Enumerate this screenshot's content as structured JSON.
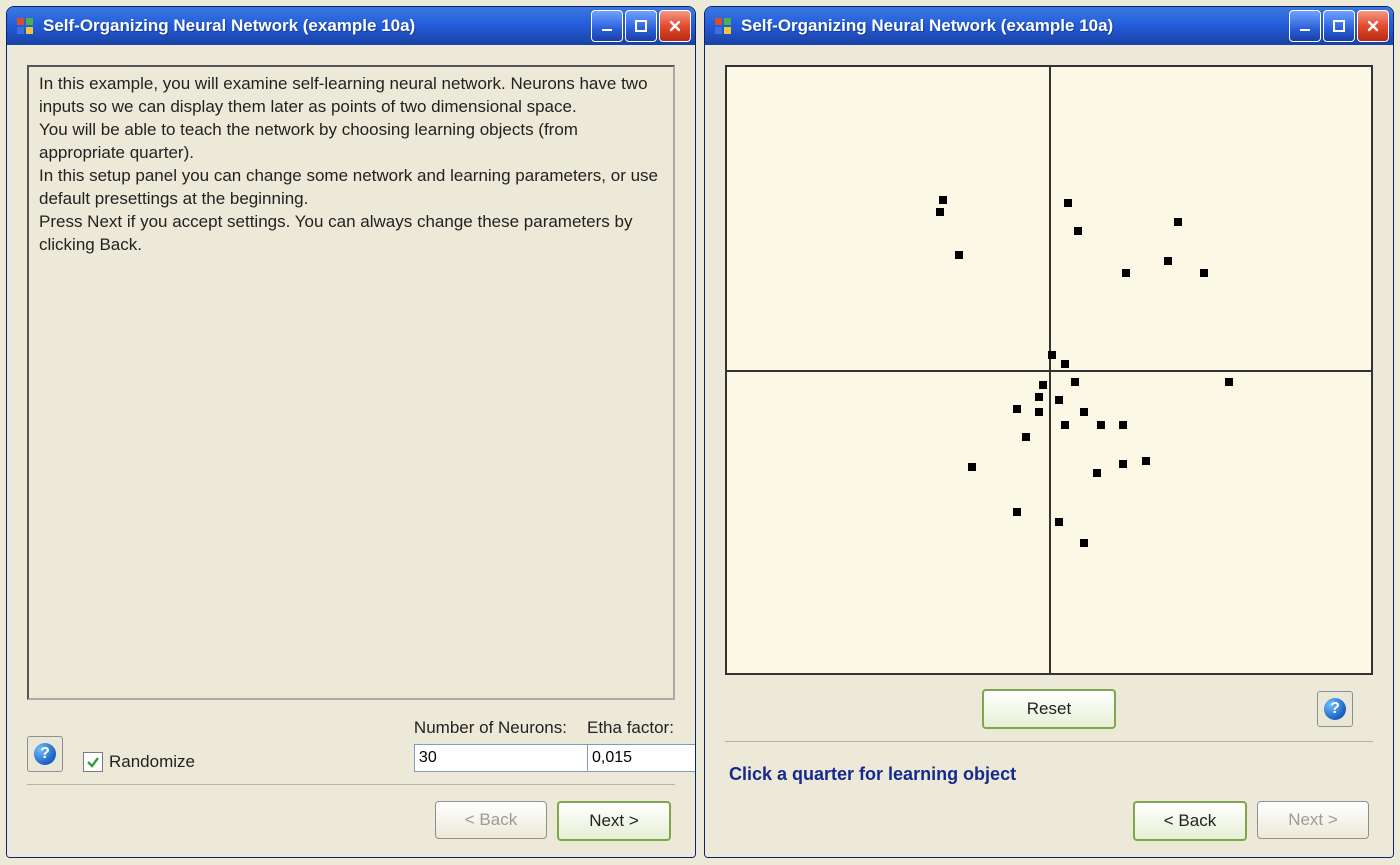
{
  "windows": {
    "left": {
      "title": "Self-Organizing Neural Network (example 10a)",
      "description": "In this example, you will examine self-learning neural network. Neurons have two inputs so we can display them later as points of two dimensional space.\nYou will be able to teach the network by choosing learning objects (from appropriate quarter).\nIn this setup panel you can change some network and learning parameters, or use default presettings at the beginning.\nPress Next if you accept settings. You can always change these parameters by clicking Back.",
      "randomize_label": "Randomize",
      "randomize_checked": true,
      "neurons_label": "Number of Neurons:",
      "neurons_value": "30",
      "etha_label": "Etha factor:",
      "etha_value": "0,015",
      "back_label": "< Back",
      "next_label": "Next >",
      "back_enabled": false,
      "next_enabled": true
    },
    "right": {
      "title": "Self-Organizing Neural Network (example 10a)",
      "reset_label": "Reset",
      "hint": "Click a quarter for learning object",
      "back_label": "< Back",
      "next_label": "Next >",
      "back_enabled": true,
      "next_enabled": false
    }
  },
  "chart_data": {
    "type": "scatter",
    "title": "",
    "xlabel": "",
    "ylabel": "",
    "xlim": [
      -1,
      1
    ],
    "ylim": [
      -1,
      1
    ],
    "series": [
      {
        "name": "neurons",
        "points": [
          {
            "x": -0.34,
            "y": 0.52
          },
          {
            "x": -0.33,
            "y": 0.56
          },
          {
            "x": 0.06,
            "y": 0.55
          },
          {
            "x": -0.28,
            "y": 0.38
          },
          {
            "x": 0.09,
            "y": 0.46
          },
          {
            "x": 0.4,
            "y": 0.49
          },
          {
            "x": 0.37,
            "y": 0.36
          },
          {
            "x": 0.24,
            "y": 0.32
          },
          {
            "x": 0.48,
            "y": 0.32
          },
          {
            "x": 0.56,
            "y": -0.04
          },
          {
            "x": 0.01,
            "y": 0.05
          },
          {
            "x": 0.05,
            "y": 0.02
          },
          {
            "x": -0.02,
            "y": -0.05
          },
          {
            "x": -0.03,
            "y": -0.09
          },
          {
            "x": -0.1,
            "y": -0.13
          },
          {
            "x": -0.07,
            "y": -0.22
          },
          {
            "x": 0.03,
            "y": -0.1
          },
          {
            "x": 0.05,
            "y": -0.18
          },
          {
            "x": 0.11,
            "y": -0.14
          },
          {
            "x": 0.16,
            "y": -0.18
          },
          {
            "x": 0.23,
            "y": -0.18
          },
          {
            "x": 0.15,
            "y": -0.34
          },
          {
            "x": 0.23,
            "y": -0.31
          },
          {
            "x": 0.3,
            "y": -0.3
          },
          {
            "x": -0.24,
            "y": -0.32
          },
          {
            "x": -0.1,
            "y": -0.47
          },
          {
            "x": 0.03,
            "y": -0.5
          },
          {
            "x": 0.11,
            "y": -0.57
          },
          {
            "x": -0.03,
            "y": -0.14
          },
          {
            "x": 0.08,
            "y": -0.04
          }
        ]
      }
    ]
  }
}
